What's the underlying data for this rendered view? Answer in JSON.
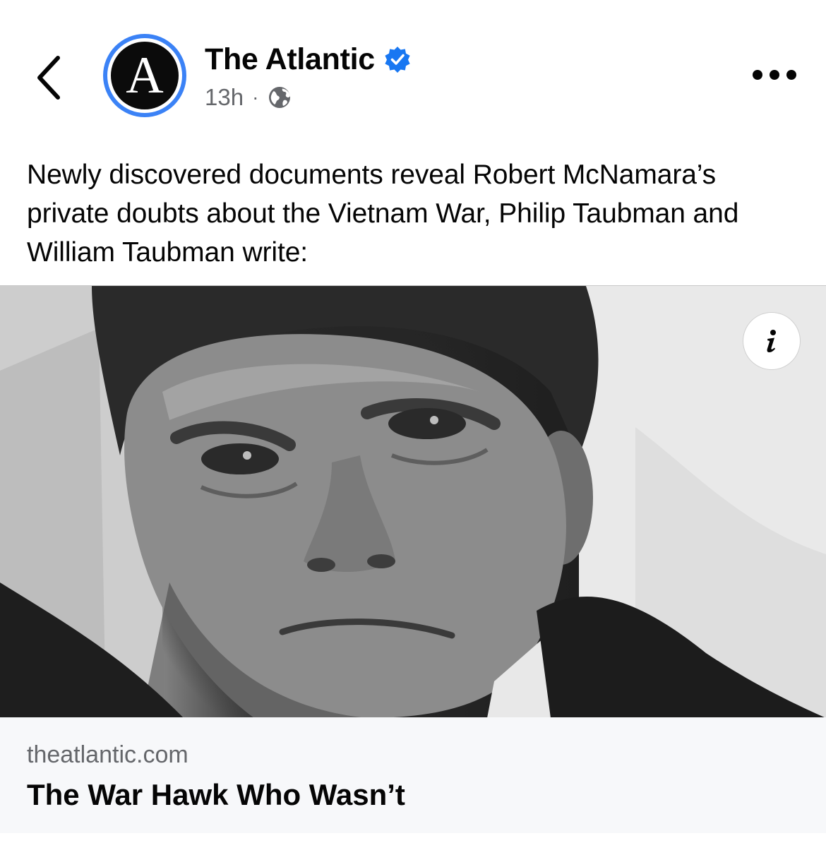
{
  "post": {
    "page_name": "The Atlantic",
    "avatar_letter": "A",
    "time": "13h",
    "separator": "·",
    "audience_icon": "globe-icon",
    "verified_icon": "verified-badge-icon",
    "text": "Newly discovered documents reveal Robert McNamara’s private doubts about the Vietnam War, Philip Taubman and William Taubman write:"
  },
  "link": {
    "domain": "theatlantic.com",
    "title": "The War Hawk Who Wasn’t"
  },
  "icons": {
    "back": "chevron-left-icon",
    "more": "more-horizontal-icon",
    "info": "info-icon"
  },
  "colors": {
    "verified": "#1877f2",
    "avatar_ring": "#3b82f6",
    "secondary_text": "#65676b",
    "link_card_bg": "#f7f8fa"
  }
}
